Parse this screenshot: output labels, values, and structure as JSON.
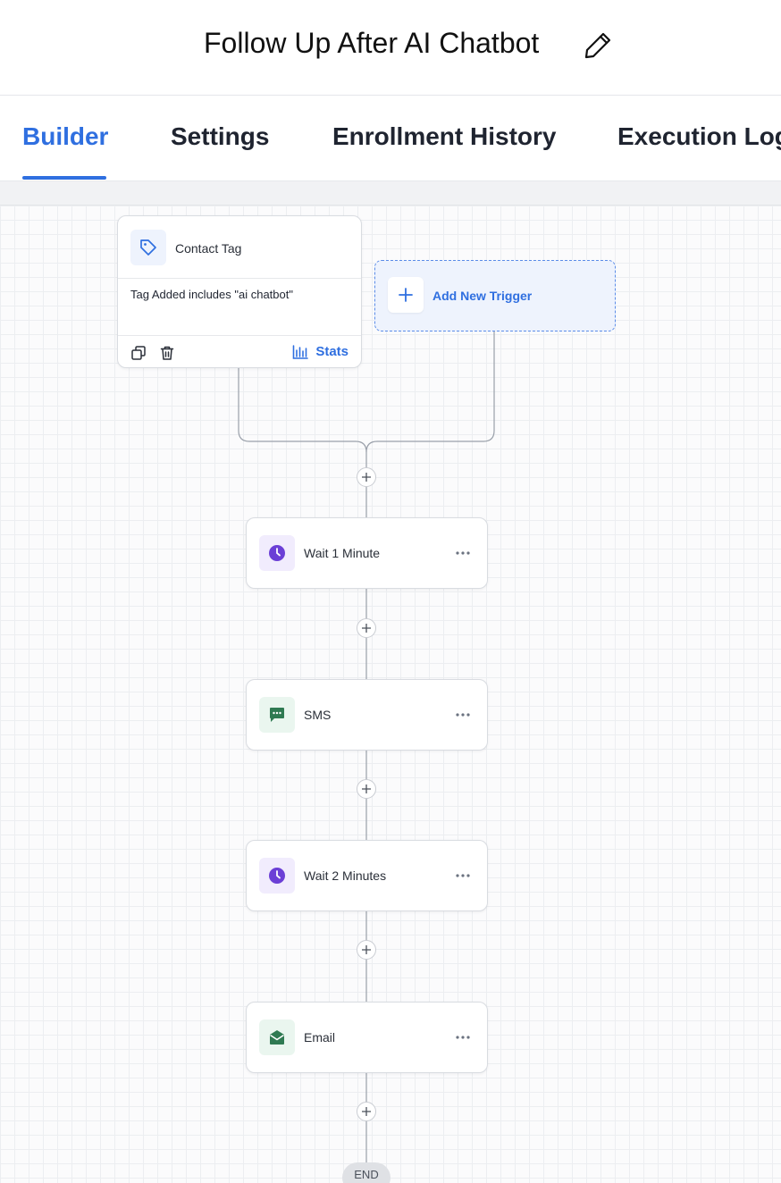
{
  "header": {
    "title": "Follow Up After AI Chatbot"
  },
  "tabs": [
    {
      "label": "Builder",
      "active": true
    },
    {
      "label": "Settings",
      "active": false
    },
    {
      "label": "Enrollment History",
      "active": false
    },
    {
      "label": "Execution Logs",
      "active": false
    }
  ],
  "trigger": {
    "title": "Contact Tag",
    "description": "Tag Added includes \"ai chatbot\"",
    "stats_label": "Stats",
    "icon": "tag-icon"
  },
  "add_trigger": {
    "label": "Add New Trigger"
  },
  "actions": [
    {
      "label": "Wait 1 Minute",
      "icon": "clock-icon",
      "color": "#6b3fd6"
    },
    {
      "label": "SMS",
      "icon": "chat-icon",
      "color": "#2f7a52"
    },
    {
      "label": "Wait 2 Minutes",
      "icon": "clock-icon",
      "color": "#6b3fd6"
    },
    {
      "label": "Email",
      "icon": "envelope-icon",
      "color": "#2f7a52"
    }
  ],
  "end_label": "END",
  "colors": {
    "accent": "#2f6fe0",
    "wait": "#6b3fd6",
    "message": "#2f7a52"
  }
}
